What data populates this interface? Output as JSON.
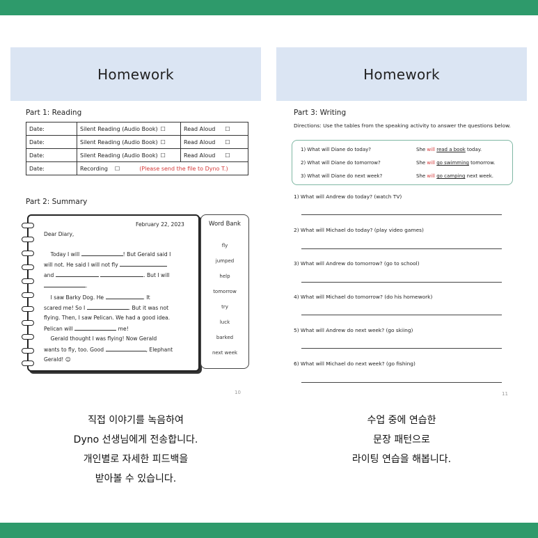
{
  "colors": {
    "accent_bar": "#2e9a6b",
    "header_bg": "#dbe5f3",
    "red_text": "#d43a3a",
    "box_border": "#7fb7a3"
  },
  "left": {
    "header": "Homework",
    "part1": "Part 1: Reading",
    "reading_rows": [
      {
        "date": "Date:",
        "activity": "Silent Reading (Audio Book)",
        "box1": "☐",
        "col3": "Read Aloud",
        "box2": "☐"
      },
      {
        "date": "Date:",
        "activity": "Silent Reading (Audio Book)",
        "box1": "☐",
        "col3": "Read Aloud",
        "box2": "☐"
      },
      {
        "date": "Date:",
        "activity": "Silent Reading (Audio Book)",
        "box1": "☐",
        "col3": "Read Aloud",
        "box2": "☐"
      },
      {
        "date": "Date:",
        "activity": "Recording",
        "box1": "☐",
        "col3": "(Please send the file to Dyno T.)",
        "box2": ""
      }
    ],
    "part2": "Part 2: Summary",
    "diary": {
      "date": "February 22, 2023",
      "greeting": "Dear Diary,",
      "l1": "Today I will",
      "l1b": "! But Gerald said I",
      "l2": "will not. He said I will not fly",
      "l3a": "and",
      "l3b": ". But I will",
      "l5a": "I saw Barky Dog. He",
      "l5b": ". It",
      "l6a": "scared me! So I",
      "l6b": ". But it was not",
      "l7": "flying. Then, I saw Pelican. We had a good idea.",
      "l8a": "Pelican will",
      "l8b": "me!",
      "l9": "Gerald thought I was flying! Now Gerald",
      "l10a": "wants to fly, too. Good",
      "l10b": ", Elephant",
      "l11": "Gerald! ☺"
    },
    "word_bank": {
      "title": "Word Bank",
      "words": [
        "fly",
        "jumped",
        "help",
        "tomorrow",
        "try",
        "luck",
        "barked",
        "next week"
      ]
    },
    "page_number": "10"
  },
  "right": {
    "header": "Homework",
    "part3": "Part 3: Writing",
    "directions": "Directions: Use the tables from the speaking activity to answer the questions below.",
    "examples": [
      {
        "q": "1)  What will Diane do today?",
        "a1": "She ",
        "a2": "will",
        "a3": "read a book",
        "a4": " today."
      },
      {
        "q": "2)  What will Diane do tomorrow?",
        "a1": "She ",
        "a2": "will",
        "a3": "go swimming",
        "a4": " tomorrow."
      },
      {
        "q": "3)  What will Diane do next week?",
        "a1": "She ",
        "a2": "will",
        "a3": "go camping",
        "a4": " next week."
      }
    ],
    "questions": [
      "1)  What will Andrew do today? (watch TV)",
      "2)  What will Michael do today? (play video games)",
      "3)  What will Andrew do tomorrow? (go to school)",
      "4) What will Michael do tomorrow? (do his homework)",
      "5)  What will Andrew do next week? (go skiing)",
      "6)  What will Michael do next week? (go fishing)"
    ],
    "page_number": "11"
  },
  "captions": {
    "left": [
      "직접 이야기를 녹음하여",
      "Dyno 선생님에게 전송합니다.",
      "개인별로 자세한 피드백을",
      "받아볼 수 있습니다."
    ],
    "right": [
      "수업 중에 연습한",
      "문장 패턴으로",
      "라이팅 연습을 해봅니다."
    ]
  }
}
